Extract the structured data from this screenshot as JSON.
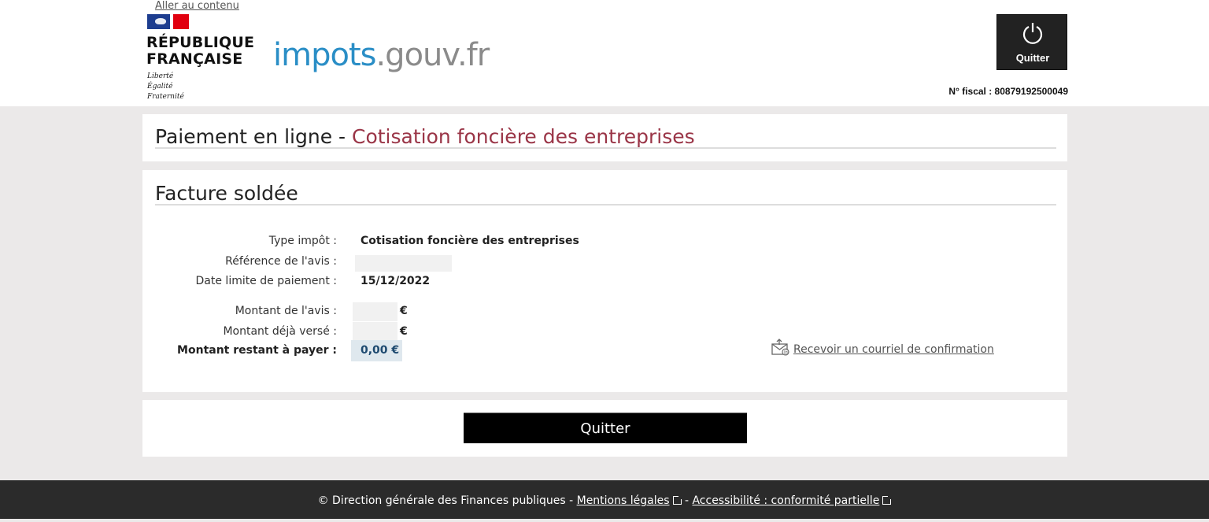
{
  "header": {
    "skip_link": "Aller au contenu",
    "republique_line1": "RÉPUBLIQUE",
    "republique_line2": "FRANÇAISE",
    "motto_1": "Liberté",
    "motto_2": "Égalité",
    "motto_3": "Fraternité",
    "logo_part1": "impots",
    "logo_part2": ".gouv.fr",
    "quit_label": "Quitter",
    "fiscal_label": "N° fiscal : 80879192500049"
  },
  "title_panel": {
    "prefix": "Paiement en ligne - ",
    "title": "Cotisation foncière des entreprises"
  },
  "invoice": {
    "heading": "Facture soldée",
    "type_label": "Type impôt :",
    "type_value": "Cotisation foncière des entreprises",
    "ref_label": "Référence de l'avis :",
    "date_label": "Date limite de paiement :",
    "date_value": "15/12/2022",
    "montant_avis_label": "Montant de l'avis :",
    "montant_verse_label": "Montant déjà versé :",
    "euro": "€",
    "restant_label": "Montant restant à payer :",
    "restant_value": "0,00 €",
    "email_link": "Recevoir un courriel de confirmation"
  },
  "actions": {
    "quit_button": "Quitter"
  },
  "footer": {
    "copyright": "© Direction générale des Finances publiques - ",
    "mentions": "Mentions légales",
    "separator": " - ",
    "accessibilite": "Accessibilité : conformité partielle"
  }
}
